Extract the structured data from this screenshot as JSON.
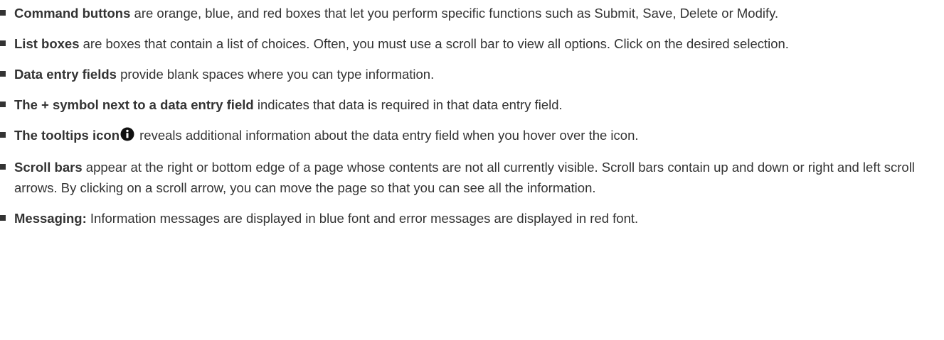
{
  "items": [
    {
      "term": "Command buttons",
      "text": " are orange, blue, and red boxes that let you perform specific functions such as Submit, Save, Delete or Modify."
    },
    {
      "term": "List boxes",
      "text": " are boxes that contain a list of choices. Often, you must use a scroll bar to view all options. Click on the desired selection."
    },
    {
      "term": "Data entry fields",
      "text": " provide blank spaces where you can type information."
    },
    {
      "term": "The + symbol next to a data entry field",
      "text": " indicates that data is required in that data entry field."
    },
    {
      "term": "The tooltips icon",
      "icon": "info-icon",
      "text": " reveals additional information about the data entry field when you hover over the icon."
    },
    {
      "term": "Scroll bars",
      "text": " appear at the right or bottom edge of a page whose contents are not all currently visible. Scroll bars contain up and down or right and left scroll arrows. By clicking on a scroll arrow, you can move the page so that you can see all the information."
    },
    {
      "term": "Messaging:",
      "text": " Information messages are displayed in blue font and error messages are displayed in red font."
    }
  ]
}
